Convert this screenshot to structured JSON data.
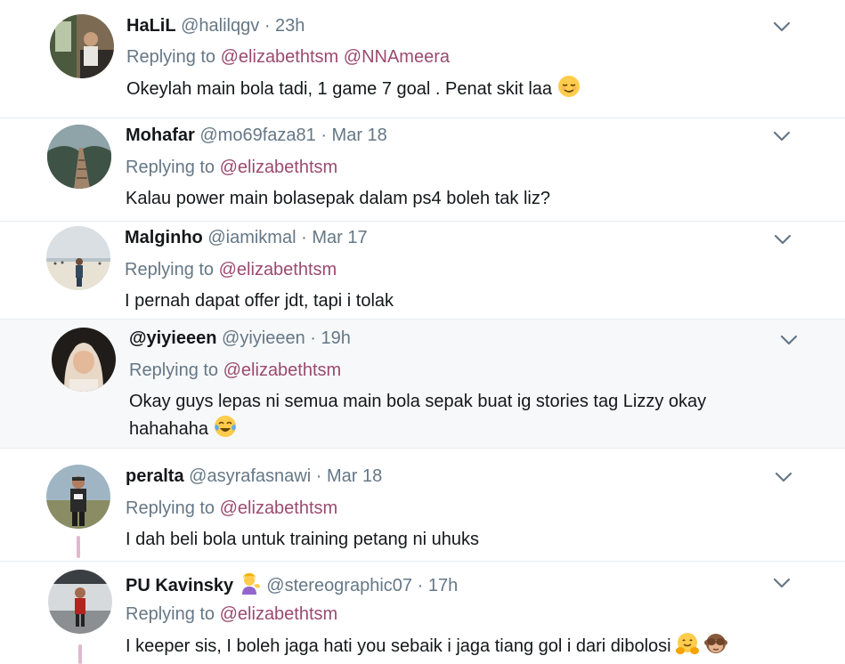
{
  "replying_to_label": "Replying to",
  "tweets": [
    {
      "name": "HaLiL",
      "handle": "@halilqgv",
      "separator": "·",
      "time": "23h",
      "mentions": [
        "@elizabethtsm",
        "@NNAmeera"
      ],
      "text": "Okeylah main bola tadi, 1 game 7 goal . Penat skit laa",
      "emoji": [
        "relieved-face"
      ]
    },
    {
      "name": "Mohafar",
      "handle": "@mo69faza81",
      "separator": "·",
      "time": "Mar 18",
      "mentions": [
        "@elizabethtsm"
      ],
      "text": "Kalau power main bolasepak dalam ps4 boleh tak liz?",
      "emoji": []
    },
    {
      "name": "Malginho",
      "handle": "@iamikmal",
      "separator": "·",
      "time": "Mar 17",
      "mentions": [
        "@elizabethtsm"
      ],
      "text": "I pernah dapat offer jdt, tapi i tolak",
      "emoji": []
    },
    {
      "name": "@yiyieeen",
      "handle": "@yiyieeen",
      "separator": "·",
      "time": "19h",
      "mentions": [
        "@elizabethtsm"
      ],
      "text_line1": "Okay guys lepas ni semua main bola sepak buat ig stories tag Lizzy okay",
      "text_line2": "hahahaha",
      "emoji": [
        "tears-of-joy-face"
      ]
    },
    {
      "name": "peralta",
      "handle": "@asyrafasnawi",
      "separator": "·",
      "time": "Mar 18",
      "mentions": [
        "@elizabethtsm"
      ],
      "text": "I dah beli bola untuk training petang ni uhuks",
      "emoji": []
    },
    {
      "name": "PU Kavinsky",
      "name_emoji": "person-tipping-hand",
      "handle": "@stereographic07",
      "separator": "·",
      "time": "17h",
      "mentions": [
        "@elizabethtsm"
      ],
      "text": "I keeper sis, I boleh jaga hati you sebaik i jaga tiang gol i dari dibolosi",
      "emoji": [
        "hugging-face",
        "see-no-evil-monkey"
      ]
    }
  ],
  "colors": {
    "mention": "#9b4a6e",
    "muted": "#657786",
    "text": "#14171a",
    "thread_line": "#e0b9cd",
    "separator": "#e6ecf0"
  }
}
